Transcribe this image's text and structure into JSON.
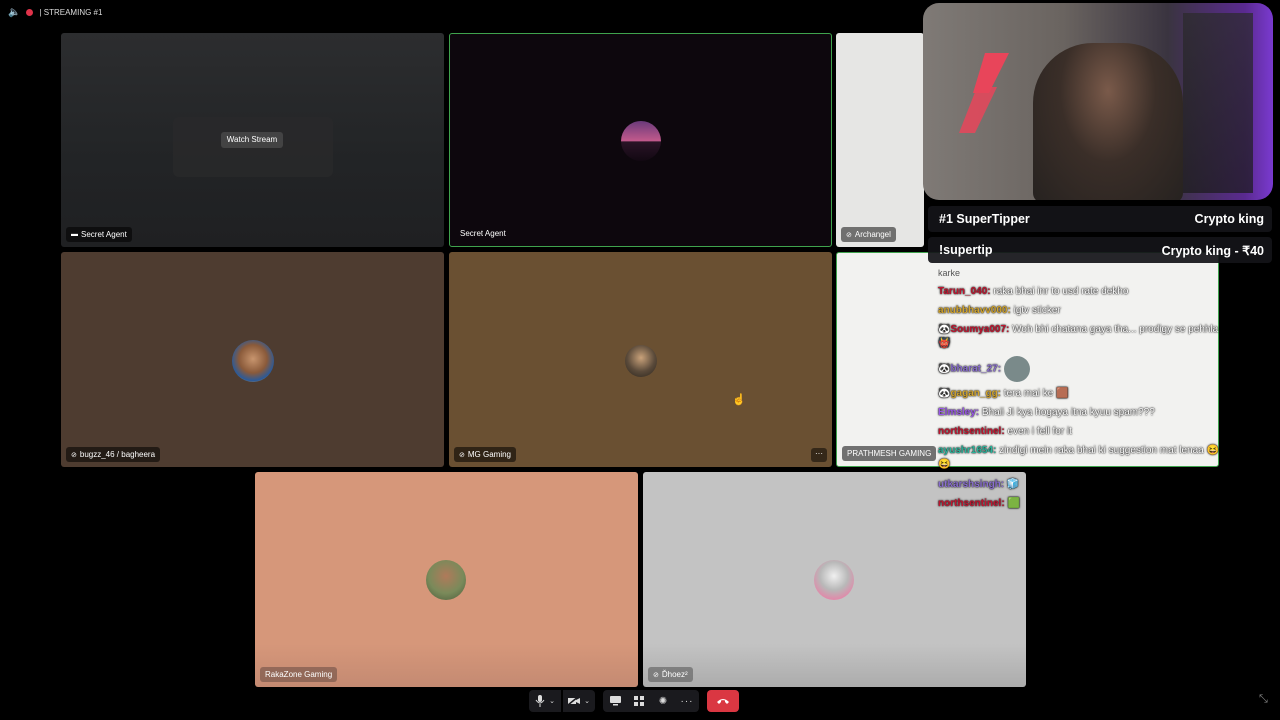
{
  "topbar": {
    "title": "| STREAMING #1"
  },
  "tiles": {
    "t1": {
      "name": "Secret Agent",
      "button": "Watch Stream"
    },
    "t2": {
      "name": "Secret Agent"
    },
    "t3": {
      "name": "Archangel"
    },
    "t4": {
      "name": "bugzz_46 / bagheera"
    },
    "t5": {
      "name": "MG Gaming",
      "more": "···"
    },
    "t6": {
      "name": "PRATHMESH GAMING"
    },
    "t7": {
      "name": "RakaZone Gaming"
    },
    "t8": {
      "name": "Ďhoez²"
    }
  },
  "overlay": {
    "super_tipper_title": "#1 SuperTipper",
    "super_tipper_name": "Crypto king",
    "supertip_cmd": "!supertip",
    "supertip_value": "Crypto king - ₹40"
  },
  "chat": [
    {
      "user": "",
      "msg": "karke",
      "color": "#ffffff"
    },
    {
      "user": "Tarun_040:",
      "msg": " raka bhai inr to usd rate dekho",
      "color": "#c0152f"
    },
    {
      "user": "anubbhavv000:",
      "msg": " igtv sticker",
      "color": "#d2a52e"
    },
    {
      "user": "Soumya007:",
      "msg": " Woh bhi chatana gaya tha... prodigy se pehhla",
      "color": "#c0152f"
    },
    {
      "user": "bharat_27:",
      "msg": "",
      "color": "#8a6fcf"
    },
    {
      "user": "gagan_gg:",
      "msg": " tera mai ke",
      "color": "#d2a52e"
    },
    {
      "user": "Elmsley:",
      "msg": " Bhaii Ji kya hogaya itna kyuu spam???",
      "color": "#9b59e8"
    },
    {
      "user": "northsentinel:",
      "msg": " even i fell for it",
      "color": "#c0152f"
    },
    {
      "user": "ayushr1654:",
      "msg": " zindigi mein raka bhai ki suggestion mat lenaa",
      "color": "#2bb39a"
    },
    {
      "user": "utkarshsingh:",
      "msg": "",
      "color": "#8a6fcf"
    },
    {
      "user": "northsentinel:",
      "msg": "",
      "color": "#c0152f"
    }
  ],
  "colors": {
    "accent_green": "#3fa34d",
    "leave_red": "#da3742"
  }
}
